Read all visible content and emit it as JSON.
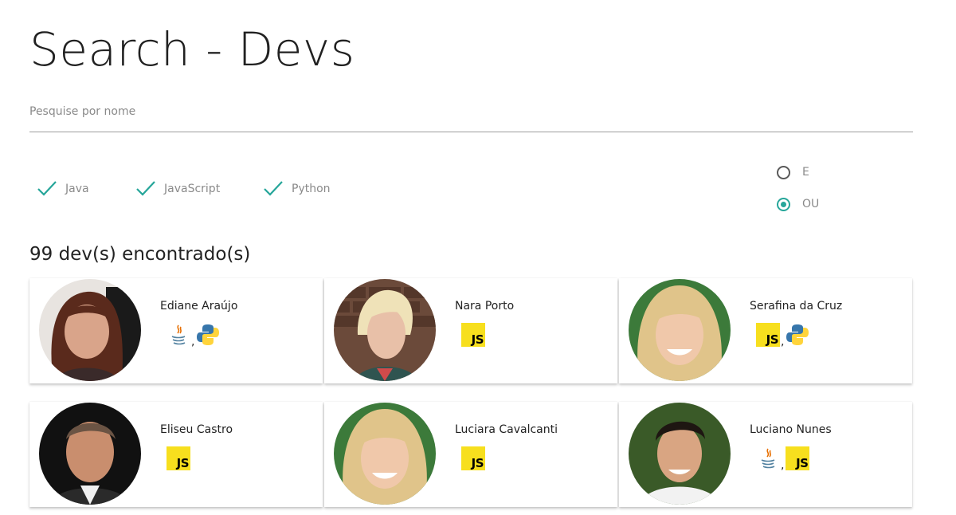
{
  "title": "Search - Devs",
  "search": {
    "placeholder": "Pesquise por nome",
    "value": ""
  },
  "filters": [
    {
      "label": "Java",
      "checked": true
    },
    {
      "label": "JavaScript",
      "checked": true
    },
    {
      "label": "Python",
      "checked": true
    }
  ],
  "mode": {
    "options": [
      {
        "label": "E",
        "selected": false
      },
      {
        "label": "OU",
        "selected": true
      }
    ]
  },
  "results_count": "99 dev(s) encontrado(s)",
  "colors": {
    "accent": "#26a69a",
    "js_yellow": "#f7df1e",
    "python_blue": "#3776ab",
    "python_yellow": "#ffd43b",
    "java_blue": "#5382a1",
    "java_red": "#e76f00"
  },
  "devs": [
    {
      "name": "Ediane Araújo",
      "langs": [
        "java-icon",
        "python-icon"
      ],
      "separator": ","
    },
    {
      "name": "Nara Porto",
      "langs": [
        "js-icon"
      ],
      "separator": ""
    },
    {
      "name": "Serafina da Cruz",
      "langs": [
        "js-icon",
        "python-icon"
      ],
      "separator": ","
    },
    {
      "name": "Eliseu Castro",
      "langs": [
        "js-icon"
      ],
      "separator": ""
    },
    {
      "name": "Luciara Cavalcanti",
      "langs": [
        "js-icon"
      ],
      "separator": ""
    },
    {
      "name": "Luciano Nunes",
      "langs": [
        "java-icon",
        "js-icon"
      ],
      "separator": ","
    }
  ],
  "js_badge": "JS"
}
